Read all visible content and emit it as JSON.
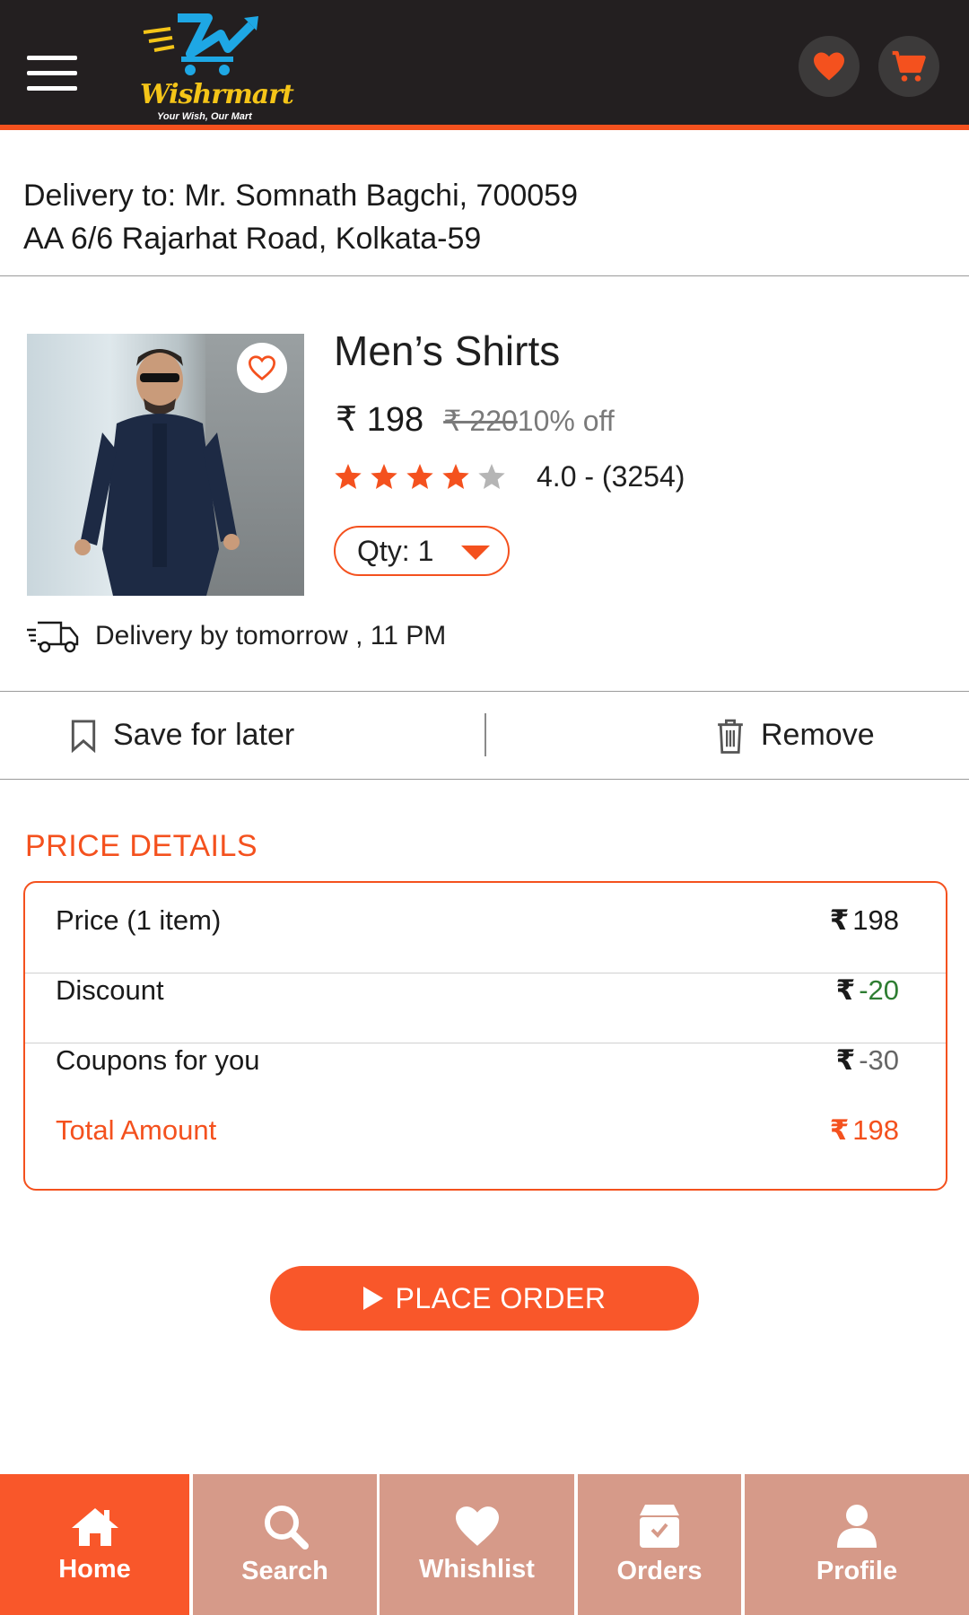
{
  "header": {
    "brand": "Wishrmart",
    "tagline": "Your Wish, Our Mart"
  },
  "address": {
    "line1": "Delivery to: Mr. Somnath Bagchi, 700059",
    "line2": "AA 6/6 Rajarhat Road, Kolkata-59"
  },
  "product": {
    "title": "Men’s Shirts",
    "price": "₹ 198",
    "old_price": "₹ 220 ",
    "discount": "10% off",
    "rating_value": 4,
    "rating_text": "4.0 - (3254)",
    "qty_label": "Qty: 1",
    "delivery_text": "Delivery by tomorrow , 11 PM"
  },
  "actions": {
    "save_label": "Save for later",
    "remove_label": "Remove"
  },
  "price_details": {
    "title": "PRICE DETAILS",
    "rows": [
      {
        "label": "Price (1 item)",
        "currency": "₹",
        "value": "198"
      },
      {
        "label": "Discount",
        "currency": "₹",
        "value": "-20"
      },
      {
        "label": "Coupons for you",
        "currency": "₹",
        "value": "-30"
      },
      {
        "label": "Total Amount",
        "currency": "₹",
        "value": "198"
      }
    ]
  },
  "place_order_label": "PLACE ORDER",
  "bottom_nav": [
    {
      "label": "Home",
      "icon": "home-icon"
    },
    {
      "label": "Search",
      "icon": "search-icon"
    },
    {
      "label": "Whishlist",
      "icon": "heart-icon"
    },
    {
      "label": "Orders",
      "icon": "orders-box-icon"
    },
    {
      "label": "Profile",
      "icon": "profile-icon"
    }
  ],
  "colors": {
    "accent": "#f4511e",
    "header_bg": "#231f20",
    "nav_inactive": "#d69a89",
    "discount_green": "#2e7d32"
  }
}
